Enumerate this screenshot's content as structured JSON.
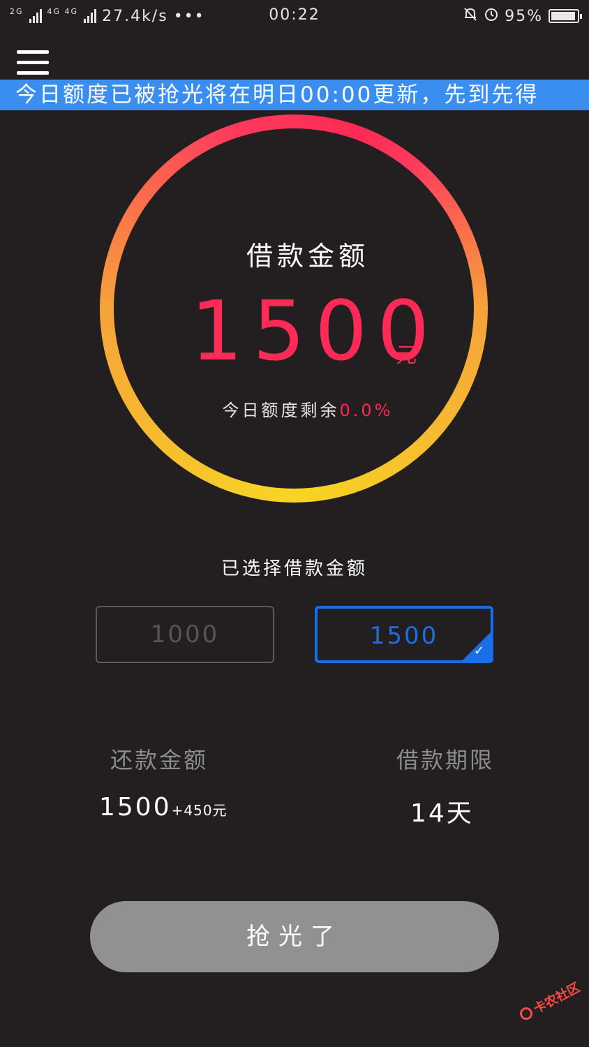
{
  "status_bar": {
    "net_left": "2G",
    "net_right": "4G 4G",
    "speed": "27.4k/s",
    "more": "•••",
    "time": "00:22",
    "battery": "95%"
  },
  "banner": {
    "text": "今日额度已被抢光将在明日00:00更新，先到先得"
  },
  "gauge": {
    "title": "借款金额",
    "amount": "1500",
    "unit": "元",
    "quota_label": "今日额度剩余",
    "quota_value": "0.0%",
    "colors": {
      "top": "#ff2a55",
      "bottom": "#f7d623"
    }
  },
  "selection": {
    "label": "已选择借款金额",
    "options": [
      {
        "label": "1000",
        "selected": false
      },
      {
        "label": "1500",
        "selected": true
      }
    ],
    "accent": "#1a6fe8"
  },
  "summary": {
    "repay_label": "还款金额",
    "repay_value": "1500",
    "repay_extra": "+450元",
    "term_label": "借款期限",
    "term_value": "14天"
  },
  "action": {
    "button_label": "抢光了"
  },
  "watermark": {
    "text": "卡农社区"
  }
}
